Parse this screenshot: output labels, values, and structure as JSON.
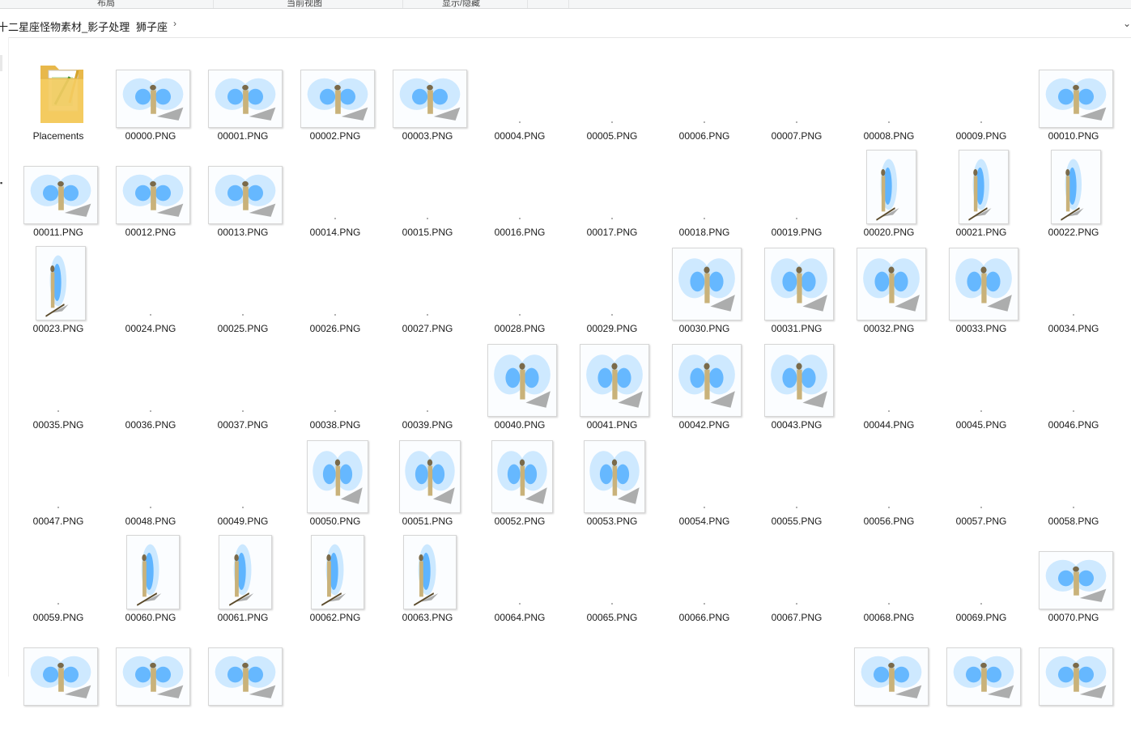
{
  "ribbon": {
    "groups": [
      "布局",
      "当前视图",
      "显示/隐藏"
    ]
  },
  "breadcrumb": {
    "parent": "十二星座怪物素材_影子处理",
    "current": "狮子座"
  },
  "folder": {
    "name": "Placements"
  },
  "files": [
    {
      "name": "00000.PNG",
      "view": "front"
    },
    {
      "name": "00001.PNG",
      "view": "front"
    },
    {
      "name": "00002.PNG",
      "view": "front"
    },
    {
      "name": "00003.PNG",
      "view": "front"
    },
    {
      "name": "00004.PNG",
      "view": "empty"
    },
    {
      "name": "00005.PNG",
      "view": "empty"
    },
    {
      "name": "00006.PNG",
      "view": "empty"
    },
    {
      "name": "00007.PNG",
      "view": "empty"
    },
    {
      "name": "00008.PNG",
      "view": "empty"
    },
    {
      "name": "00009.PNG",
      "view": "empty"
    },
    {
      "name": "00010.PNG",
      "view": "front"
    },
    {
      "name": "00011.PNG",
      "view": "front"
    },
    {
      "name": "00012.PNG",
      "view": "front"
    },
    {
      "name": "00013.PNG",
      "view": "front"
    },
    {
      "name": "00014.PNG",
      "view": "empty"
    },
    {
      "name": "00015.PNG",
      "view": "empty"
    },
    {
      "name": "00016.PNG",
      "view": "empty"
    },
    {
      "name": "00017.PNG",
      "view": "empty"
    },
    {
      "name": "00018.PNG",
      "view": "empty"
    },
    {
      "name": "00019.PNG",
      "view": "empty"
    },
    {
      "name": "00020.PNG",
      "view": "side"
    },
    {
      "name": "00021.PNG",
      "view": "side"
    },
    {
      "name": "00022.PNG",
      "view": "side"
    },
    {
      "name": "00023.PNG",
      "view": "side"
    },
    {
      "name": "00024.PNG",
      "view": "empty"
    },
    {
      "name": "00025.PNG",
      "view": "empty"
    },
    {
      "name": "00026.PNG",
      "view": "empty"
    },
    {
      "name": "00027.PNG",
      "view": "empty"
    },
    {
      "name": "00028.PNG",
      "view": "empty"
    },
    {
      "name": "00029.PNG",
      "view": "empty"
    },
    {
      "name": "00030.PNG",
      "view": "mid"
    },
    {
      "name": "00031.PNG",
      "view": "mid"
    },
    {
      "name": "00032.PNG",
      "view": "mid"
    },
    {
      "name": "00033.PNG",
      "view": "mid"
    },
    {
      "name": "00034.PNG",
      "view": "empty"
    },
    {
      "name": "00035.PNG",
      "view": "empty"
    },
    {
      "name": "00036.PNG",
      "view": "empty"
    },
    {
      "name": "00037.PNG",
      "view": "empty"
    },
    {
      "name": "00038.PNG",
      "view": "empty"
    },
    {
      "name": "00039.PNG",
      "view": "empty"
    },
    {
      "name": "00040.PNG",
      "view": "mid"
    },
    {
      "name": "00041.PNG",
      "view": "mid"
    },
    {
      "name": "00042.PNG",
      "view": "mid"
    },
    {
      "name": "00043.PNG",
      "view": "mid"
    },
    {
      "name": "00044.PNG",
      "view": "empty"
    },
    {
      "name": "00045.PNG",
      "view": "empty"
    },
    {
      "name": "00046.PNG",
      "view": "empty"
    },
    {
      "name": "00047.PNG",
      "view": "empty"
    },
    {
      "name": "00048.PNG",
      "view": "empty"
    },
    {
      "name": "00049.PNG",
      "view": "empty"
    },
    {
      "name": "00050.PNG",
      "view": "back"
    },
    {
      "name": "00051.PNG",
      "view": "back"
    },
    {
      "name": "00052.PNG",
      "view": "back"
    },
    {
      "name": "00053.PNG",
      "view": "back"
    },
    {
      "name": "00054.PNG",
      "view": "empty"
    },
    {
      "name": "00055.PNG",
      "view": "empty"
    },
    {
      "name": "00056.PNG",
      "view": "empty"
    },
    {
      "name": "00057.PNG",
      "view": "empty"
    },
    {
      "name": "00058.PNG",
      "view": "empty"
    },
    {
      "name": "00059.PNG",
      "view": "empty"
    },
    {
      "name": "00060.PNG",
      "view": "lean"
    },
    {
      "name": "00061.PNG",
      "view": "lean"
    },
    {
      "name": "00062.PNG",
      "view": "lean"
    },
    {
      "name": "00063.PNG",
      "view": "lean"
    },
    {
      "name": "00064.PNG",
      "view": "empty"
    },
    {
      "name": "00065.PNG",
      "view": "empty"
    },
    {
      "name": "00066.PNG",
      "view": "empty"
    },
    {
      "name": "00067.PNG",
      "view": "empty"
    },
    {
      "name": "00068.PNG",
      "view": "empty"
    },
    {
      "name": "00069.PNG",
      "view": "empty"
    },
    {
      "name": "00070.PNG",
      "view": "front"
    },
    {
      "name": "",
      "view": "front"
    },
    {
      "name": "",
      "view": "front"
    },
    {
      "name": "",
      "view": "front"
    },
    {
      "name": "",
      "view": "none"
    },
    {
      "name": "",
      "view": "none"
    },
    {
      "name": "",
      "view": "none"
    },
    {
      "name": "",
      "view": "none"
    },
    {
      "name": "",
      "view": "none"
    },
    {
      "name": "",
      "view": "none"
    },
    {
      "name": "",
      "view": "front"
    },
    {
      "name": "",
      "view": "front"
    },
    {
      "name": "",
      "view": "front"
    }
  ],
  "icons": {
    "chevron": "chevron-right-icon",
    "folder": "folder-icon"
  },
  "colors": {
    "wing_glow": "#3aa3ff",
    "wing_light": "#bfe2ff",
    "shadow": "#8a8a8a",
    "body": "#c9b27a"
  }
}
